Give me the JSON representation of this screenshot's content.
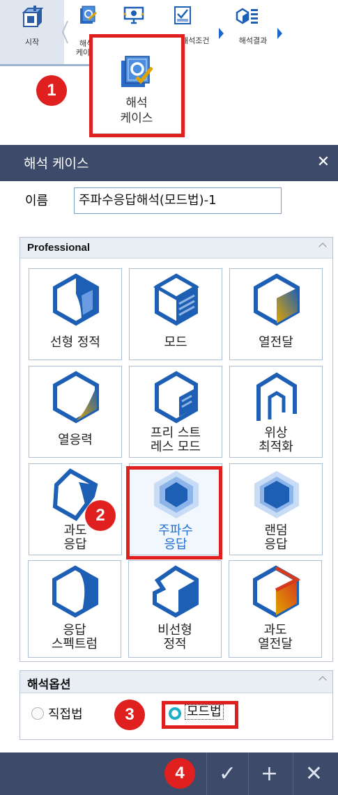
{
  "ribbon": {
    "items": [
      {
        "label": "시작",
        "icon": "home-cube-icon"
      },
      {
        "label": "해석\n케이스",
        "icon": "analysis-case-icon"
      },
      {
        "label": "",
        "icon": "monitor-icon"
      },
      {
        "label": "해석조건",
        "icon": "analysis-condition-icon"
      },
      {
        "label": "해석결과",
        "icon": "analysis-result-icon"
      }
    ],
    "popup_label_line1": "해석",
    "popup_label_line2": "케이스"
  },
  "badges": [
    "1",
    "2",
    "3",
    "4"
  ],
  "dialog": {
    "title": "해석 케이스",
    "close_symbol": "✕",
    "name_label": "이름",
    "name_value": "주파수응답해석(모드법)-1"
  },
  "professional": {
    "title": "Professional",
    "tiles": [
      {
        "line1": "선형 정적",
        "line2": ""
      },
      {
        "line1": "모드",
        "line2": ""
      },
      {
        "line1": "열전달",
        "line2": ""
      },
      {
        "line1": "열응력",
        "line2": ""
      },
      {
        "line1": "프리 스트",
        "line2": "레스 모드"
      },
      {
        "line1": "위상",
        "line2": "최적화"
      },
      {
        "line1": "과도",
        "line2": "응답"
      },
      {
        "line1": "주파수",
        "line2": "응답"
      },
      {
        "line1": "랜덤",
        "line2": "응답"
      },
      {
        "line1": "응답",
        "line2": "스펙트럼"
      },
      {
        "line1": "비선형",
        "line2": "정적"
      },
      {
        "line1": "과도",
        "line2": "열전달"
      }
    ]
  },
  "options": {
    "title": "해석옵션",
    "opt1": "직접법",
    "opt2": "모드법",
    "selected": "모드법"
  },
  "footer": {
    "ok_symbol": "✓",
    "add_symbol": "+",
    "cancel_symbol": "✕"
  },
  "colors": {
    "header_bg": "#3d4a6a",
    "accent_blue": "#1f6fd6",
    "highlight_red": "#e0201f",
    "radio_selected": "#1ab0c8"
  }
}
